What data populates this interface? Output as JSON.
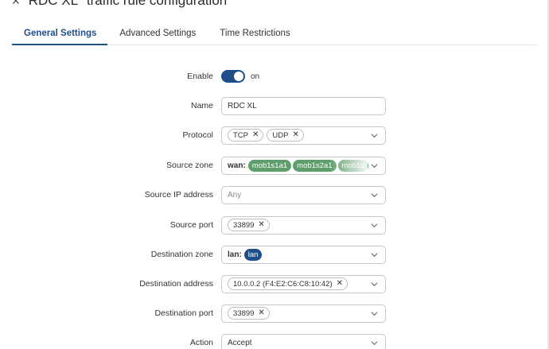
{
  "header": {
    "title": "RDC XL\" traffic rule configuration",
    "back_icon": "close-icon"
  },
  "tabs": [
    {
      "label": "General Settings",
      "active": true
    },
    {
      "label": "Advanced Settings",
      "active": false
    },
    {
      "label": "Time Restrictions",
      "active": false
    }
  ],
  "form": {
    "enable": {
      "label": "Enable",
      "state": "on",
      "checked": true
    },
    "name": {
      "label": "Name",
      "value": "RDC XL"
    },
    "protocol": {
      "label": "Protocol",
      "chips": [
        "TCP",
        "UDP"
      ]
    },
    "source_zone": {
      "label": "Source zone",
      "prefix": "wan:",
      "pills": [
        "mob1s1a1",
        "mob1s2a1",
        "mob1s"
      ]
    },
    "source_ip": {
      "label": "Source IP address",
      "placeholder": "Any"
    },
    "source_port": {
      "label": "Source port",
      "chips": [
        "33899"
      ]
    },
    "destination_zone": {
      "label": "Destination zone",
      "prefix": "lan:",
      "pills": [
        "lan"
      ]
    },
    "destination_address": {
      "label": "Destination address",
      "chips": [
        "10.0.0.2 (F4:E2:C6:C8:10:42)"
      ]
    },
    "destination_port": {
      "label": "Destination port",
      "chips": [
        "33899"
      ]
    },
    "action": {
      "label": "Action",
      "value": "Accept"
    }
  },
  "colors": {
    "accent": "#1f4f8b",
    "zone_green": "#5e9e6b",
    "border": "#c7c7c7"
  }
}
